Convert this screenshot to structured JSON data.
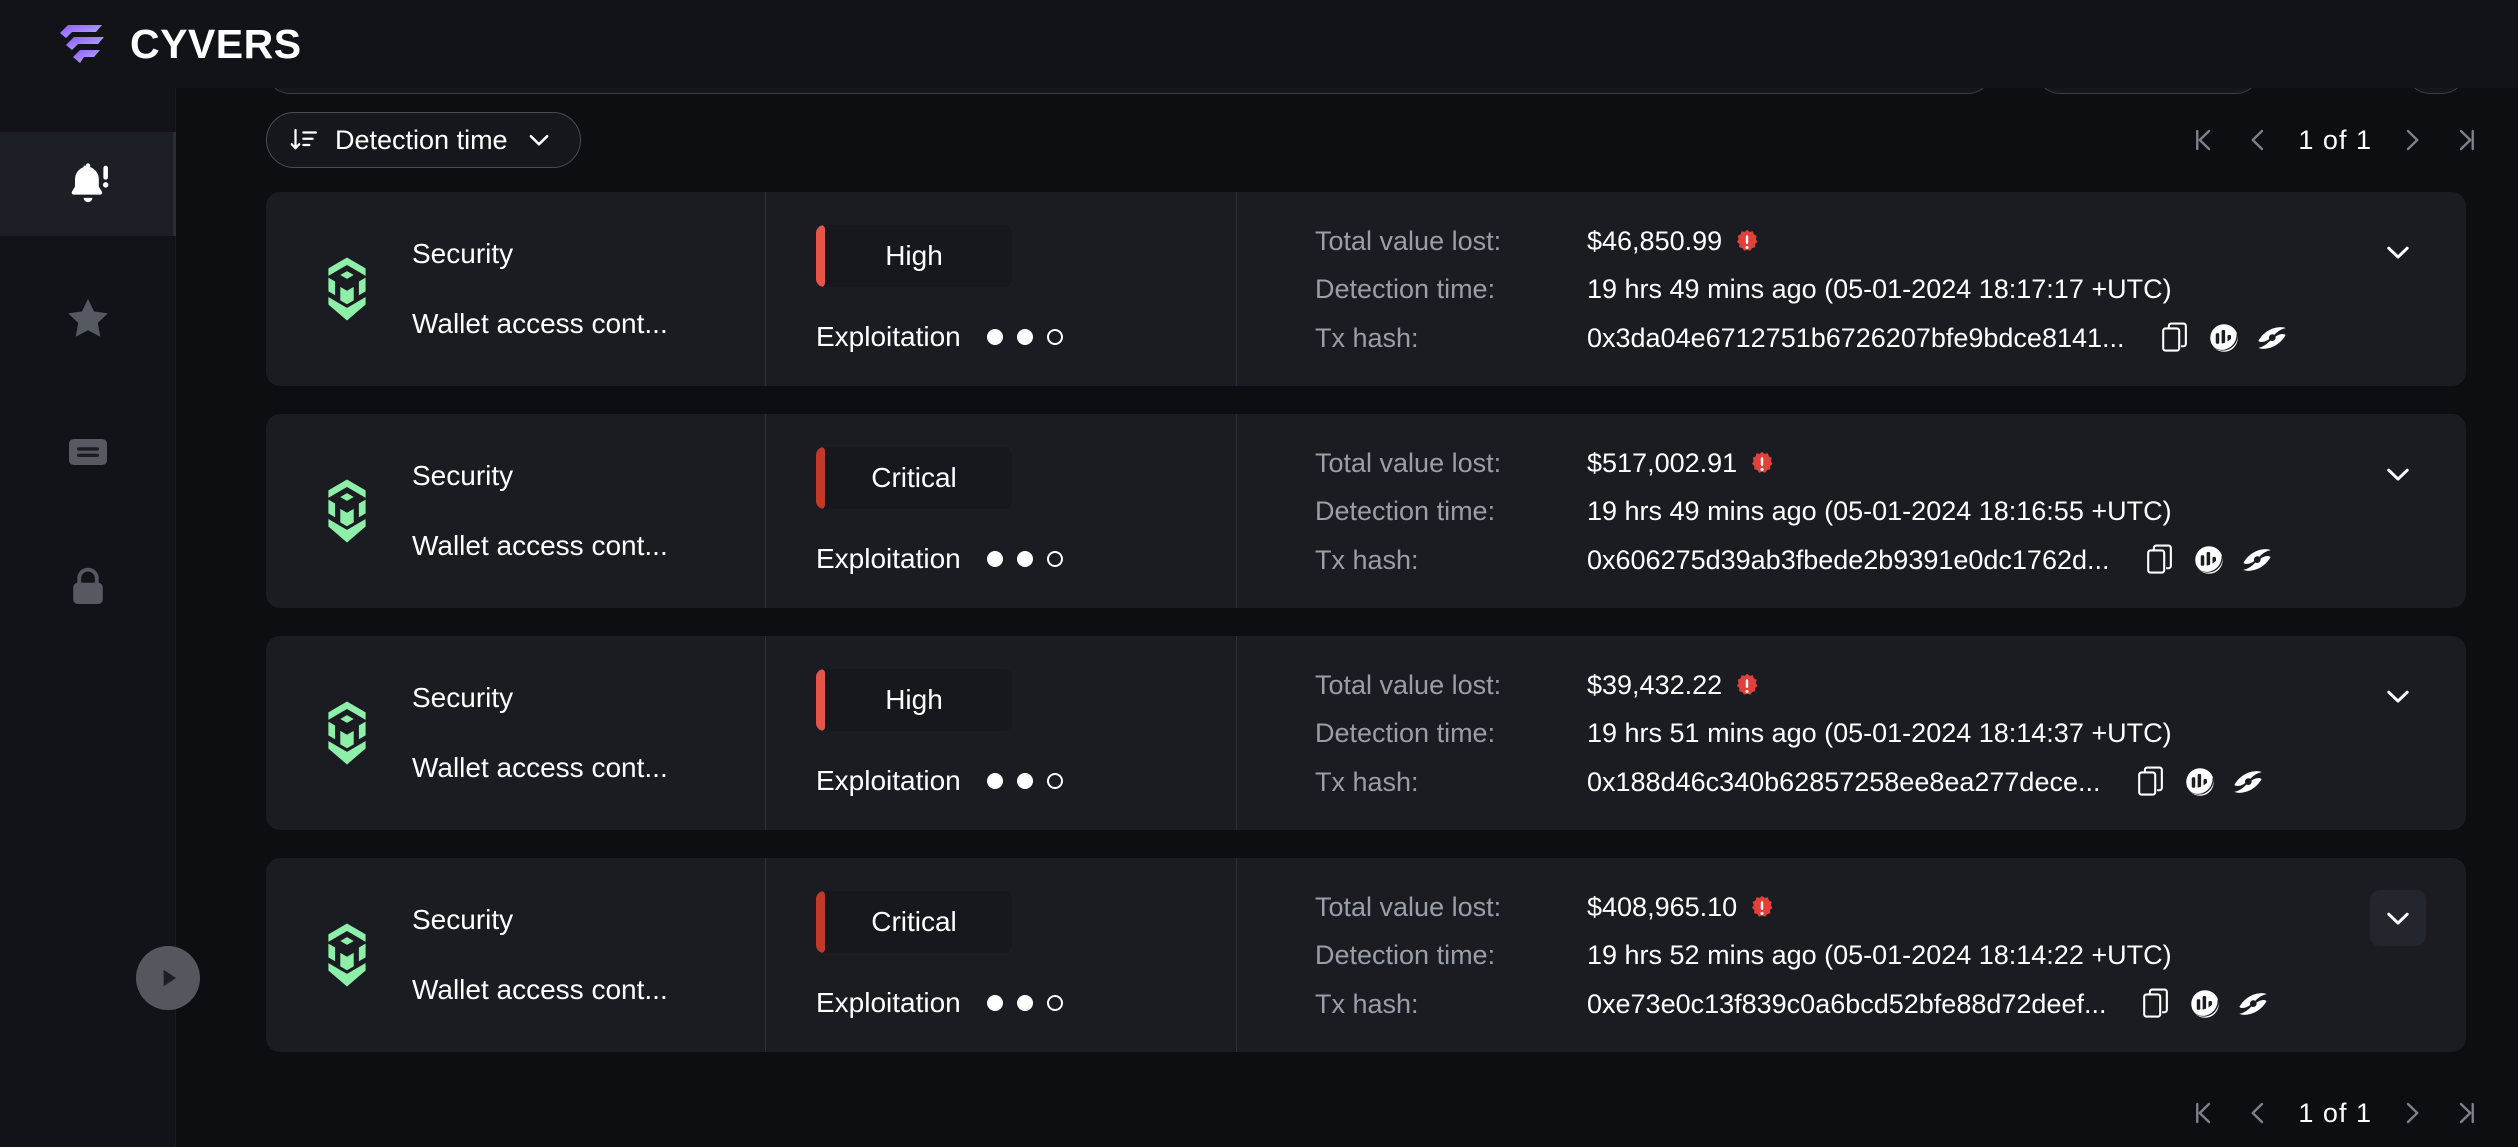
{
  "brand": {
    "name": "CYVERS",
    "logo_icon": "cyvers-logo-icon",
    "gradient_from": "#8b5cf6",
    "gradient_to": "#86efac"
  },
  "sidebar": {
    "items": [
      {
        "icon": "bell-alert-icon",
        "name": "alerts",
        "active": true
      },
      {
        "icon": "star-icon",
        "name": "favorites",
        "active": false
      },
      {
        "icon": "report-card-icon",
        "name": "reports",
        "active": false
      },
      {
        "icon": "lock-icon",
        "name": "access",
        "active": false
      }
    ],
    "toggle_icon": "play-circle-icon"
  },
  "toolbar": {
    "sort": {
      "label": "Detection time",
      "sort_icon": "sort-descending-icon",
      "chevron_icon": "chevron-down-icon"
    },
    "pagination": {
      "first_icon": "page-first-icon",
      "prev_icon": "page-prev-icon",
      "next_icon": "page-next-icon",
      "last_icon": "page-last-icon",
      "current": "1",
      "of": "of",
      "total": "1"
    }
  },
  "labels": {
    "total_value_lost": "Total value lost:",
    "detection_time": "Detection time:",
    "tx_hash": "Tx hash:",
    "copy_icon": "copy-icon",
    "explorer_icon": "bscscan-explorer-icon",
    "analyzer_icon": "blocksec-phalcon-icon",
    "warning_icon": "warning-badge-icon",
    "expand_icon": "chevron-down-icon"
  },
  "severity_colors": {
    "high": "#e4544a",
    "critical": "#c0392b"
  },
  "alerts": [
    {
      "chain_icon": "bnb-chain-icon",
      "category": "Security",
      "rule": "Wallet access cont...",
      "severity": "High",
      "severity_key": "high",
      "stage": "Exploitation",
      "stage_dots": [
        true,
        true,
        false
      ],
      "total_value_lost": "$46,850.99",
      "detection_time": "19 hrs 49 mins ago (05-01-2024 18:17:17 +UTC)",
      "tx_hash": "0x3da04e6712751b6726207bfe9bdce8141...",
      "expander_hovered": false
    },
    {
      "chain_icon": "bnb-chain-icon",
      "category": "Security",
      "rule": "Wallet access cont...",
      "severity": "Critical",
      "severity_key": "critical",
      "stage": "Exploitation",
      "stage_dots": [
        true,
        true,
        false
      ],
      "total_value_lost": "$517,002.91",
      "detection_time": "19 hrs 49 mins ago (05-01-2024 18:16:55 +UTC)",
      "tx_hash": "0x606275d39ab3fbede2b9391e0dc1762d...",
      "expander_hovered": false
    },
    {
      "chain_icon": "bnb-chain-icon",
      "category": "Security",
      "rule": "Wallet access cont...",
      "severity": "High",
      "severity_key": "high",
      "stage": "Exploitation",
      "stage_dots": [
        true,
        true,
        false
      ],
      "total_value_lost": "$39,432.22",
      "detection_time": "19 hrs 51 mins ago (05-01-2024 18:14:37 +UTC)",
      "tx_hash": "0x188d46c340b62857258ee8ea277dece...",
      "expander_hovered": false
    },
    {
      "chain_icon": "bnb-chain-icon",
      "category": "Security",
      "rule": "Wallet access cont...",
      "severity": "Critical",
      "severity_key": "critical",
      "stage": "Exploitation",
      "stage_dots": [
        true,
        true,
        false
      ],
      "total_value_lost": "$408,965.10",
      "detection_time": "19 hrs 52 mins ago (05-01-2024 18:14:22 +UTC)",
      "tx_hash": "0xe73e0c13f839c0a6bcd52bfe88d72deef...",
      "expander_hovered": true
    }
  ],
  "bottom_pagination": {
    "first_icon": "page-first-icon",
    "prev_icon": "page-prev-icon",
    "next_icon": "page-next-icon",
    "last_icon": "page-last-icon",
    "current": "1",
    "of": "of",
    "total": "1"
  }
}
